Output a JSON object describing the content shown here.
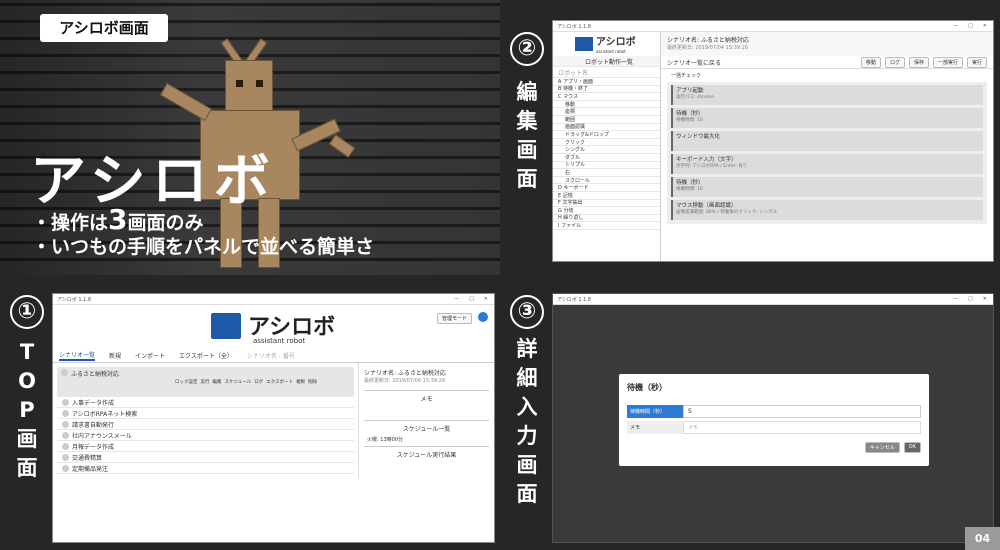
{
  "hero": {
    "tag": "アシロボ画面",
    "title": "アシロボ",
    "bullet1_pre": "・操作は",
    "bullet1_num": "3",
    "bullet1_post": "画面のみ",
    "bullet2": "・いつもの手順をパネルで並べる簡単さ"
  },
  "steps": {
    "s1": {
      "num": "①",
      "label": [
        "T",
        "O",
        "P",
        "画",
        "面"
      ]
    },
    "s2": {
      "num": "②",
      "label": [
        "編",
        "集",
        "画",
        "面"
      ]
    },
    "s3": {
      "num": "③",
      "label": [
        "詳",
        "細",
        "入",
        "力",
        "画",
        "面"
      ]
    }
  },
  "top": {
    "title": "アシロボ 1.1.8",
    "logo": "アシロボ",
    "logo_sub": "assistant robot",
    "mgmt": "管理モード",
    "tabs": [
      "シナリオ一覧",
      "新規",
      "インポート",
      "エクスポート（全）"
    ],
    "search_placeholder": "シナリオ名 - 番号",
    "scenarios": [
      "ふるさと納税対応",
      "入事データ作成",
      "アシロボRPAネット検索",
      "請求書自動発行",
      "社内アナウンスメール",
      "月報データ作成",
      "交通費精算",
      "定期備品発注"
    ],
    "actions": [
      "ロック設定",
      "実行",
      "編集",
      "スケジュール",
      "ログ",
      "エクスポート",
      "複製",
      "削除"
    ],
    "detail": {
      "name": "シナリオ名: ふるさと納税対応",
      "updated": "最終更新日: 2019/07/04 15:39:26",
      "memo": "メモ",
      "sched_title": "スケジュール一覧",
      "sched_item": "火曜: 13時00分",
      "result": "スケジュール実行結果"
    }
  },
  "edit": {
    "title": "アシロボ 1.1.8",
    "logo": "アシロボ",
    "logo_sub": "assistant robot",
    "panel_title": "ロボット動作一覧",
    "search": "ロボット名",
    "name": "シナリオ名: ふるさと納税対応",
    "updated": "最終更新日: 2019/07/04 15:39:26",
    "back": "シナリオ一覧に戻る",
    "toolbar": [
      "移動",
      "ログ",
      "保存",
      "一部実行",
      "実行"
    ],
    "group_check": "一括チェック",
    "tree": [
      "A  アプリ・画面",
      "B  待機・終了",
      "C  マウス",
      "移動",
      "座標",
      "範囲",
      "画面認識",
      "ドラッグ&ドロップ",
      "クリック",
      "シングル",
      "ダブル",
      "トリプル",
      "右",
      "スクロール",
      "D  キーボード",
      "E  記憶",
      "F  文字抽出",
      "G  分岐",
      "H  繰り返し",
      "I  ファイル"
    ],
    "blocks": [
      {
        "t": "アプリ起動",
        "d": "実行パス: chrome"
      },
      {
        "t": "待機（秒）",
        "d": "待機時間: 10"
      },
      {
        "t": "ウィンドウ最大化",
        "d": ""
      },
      {
        "t": "キーボード入力（文字）",
        "d": "文字列: アシロボRPA / Enter: 有り"
      },
      {
        "t": "待機（秒）",
        "d": "待機時間: 10"
      },
      {
        "t": "マウス移動（画面認識）",
        "d": "画像認識範囲: 80% / 移動後のクリック: シングル"
      }
    ]
  },
  "dialog": {
    "title": "待機（秒）",
    "field_label": "待機時間（秒）",
    "field_value": "5",
    "memo_label": "メモ",
    "memo_placeholder": "メモ",
    "cancel": "キャンセル",
    "ok": "OK"
  },
  "page": "04"
}
